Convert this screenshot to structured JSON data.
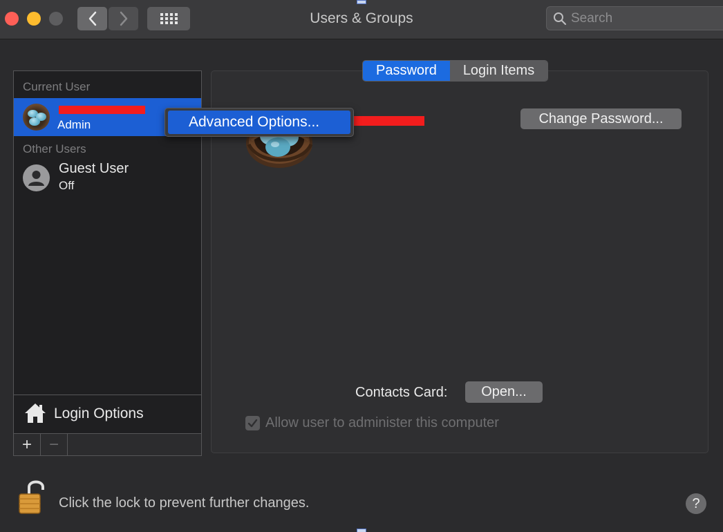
{
  "window": {
    "title": "Users & Groups"
  },
  "search": {
    "placeholder": "Search"
  },
  "sidebar": {
    "current_user_label": "Current User",
    "other_users_label": "Other Users",
    "current_user": {
      "role": "Admin"
    },
    "guest_user": {
      "name": "Guest User",
      "status": "Off"
    },
    "login_options_label": "Login Options",
    "add_symbol": "+",
    "remove_symbol": "−"
  },
  "popup": {
    "item_label": "Advanced Options..."
  },
  "tabs": [
    {
      "label": "Password",
      "active": true
    },
    {
      "label": "Login Items",
      "active": false
    }
  ],
  "main": {
    "change_password_label": "Change Password...",
    "contacts_card_label": "Contacts Card:",
    "open_label": "Open...",
    "admin_checkbox_label": "Allow user to administer this computer",
    "admin_checkbox_checked": true
  },
  "footer": {
    "lock_text": "Click the lock to prevent further changes.",
    "help_symbol": "?"
  },
  "colors": {
    "accent": "#1c5fd4",
    "redaction": "#f21d1d",
    "close": "#fe5f57",
    "minimize": "#febc2e"
  },
  "icons": [
    "back-chevron-icon",
    "forward-chevron-icon",
    "grid-icon",
    "search-icon",
    "house-icon",
    "lock-open-icon",
    "person-icon",
    "checkmark-icon",
    "help-icon"
  ]
}
